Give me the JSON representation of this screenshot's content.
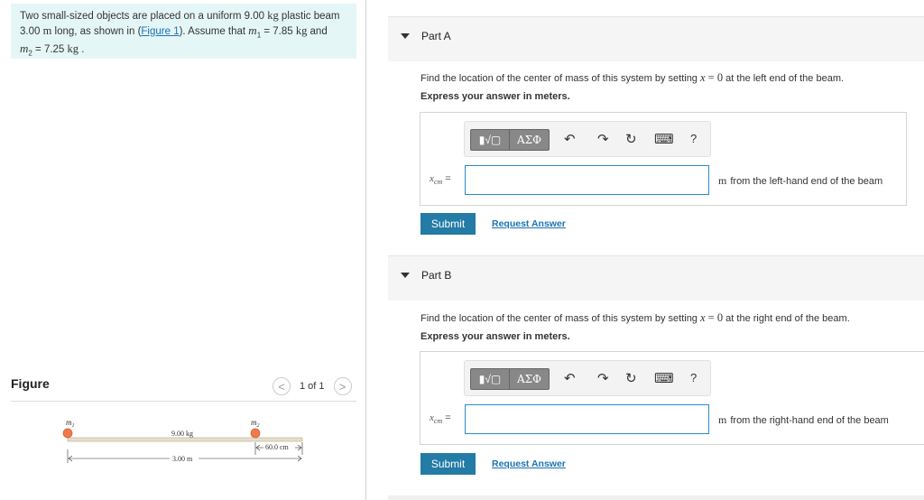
{
  "problem": {
    "text_1": "Two small-sized objects are placed on a uniform 9.00 ",
    "unit_kg": "kg",
    "text_2": " plastic beam 3.00 ",
    "unit_m": "m",
    "text_3": " long, as shown in (",
    "figure_link": "Figure 1",
    "text_4": "). Assume that ",
    "m1_symbol": "m",
    "m1_sub": "1",
    "m1_value": " = 7.85 ",
    "unit_kg_2": "kg",
    "text_5": " and",
    "m2_symbol": "m",
    "m2_sub": "2",
    "m2_value": " = 7.25 ",
    "unit_kg_3": "kg",
    "text_6": " ."
  },
  "figure": {
    "header": "Figure",
    "pager_text": "1 of 1",
    "prev": "<",
    "next": ">",
    "label_m1": "m",
    "label_m1_sub": "1",
    "label_m2": "m",
    "label_m2_sub": "2",
    "beam_mass": "9.00 kg",
    "beam_length": "3.00 m",
    "offset": "60.0 cm"
  },
  "parts": [
    {
      "title": "Part A",
      "instruction_pre": "Find the location of the center of mass of this system by setting ",
      "instruction_var": "x",
      "instruction_eq": " = 0",
      "instruction_post": " at the left end of the beam.",
      "express": "Express your answer in meters.",
      "var_symbol": "x",
      "var_sub": "cm",
      "var_eq": " =",
      "input_value": "",
      "unit_symbol": "m",
      "unit_text": "from the left-hand end of the beam",
      "submit": "Submit",
      "request": "Request Answer"
    },
    {
      "title": "Part B",
      "instruction_pre": "Find the location of the center of mass of this system by setting ",
      "instruction_var": "x",
      "instruction_eq": " = 0",
      "instruction_post": " at the right end of the beam.",
      "express": "Express your answer in meters.",
      "var_symbol": "x",
      "var_sub": "cm",
      "var_eq": " =",
      "input_value": "",
      "unit_symbol": "m",
      "unit_text": "from the right-hand end of the beam",
      "submit": "Submit",
      "request": "Request Answer"
    }
  ],
  "toolbar": {
    "template_glyph": "▮√▢",
    "greek_glyph": "ΑΣΦ",
    "undo": "↶",
    "redo": "↷",
    "reset": "↻",
    "keyboard": "⌨",
    "help": "?"
  },
  "colors": {
    "problem_bg": "#e5f6f7",
    "submit_bg": "#237ba6",
    "link": "#1a73b3",
    "ball": "#f07a4b"
  }
}
